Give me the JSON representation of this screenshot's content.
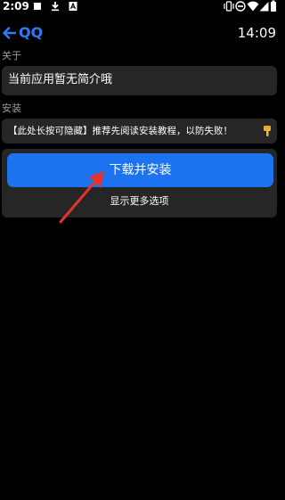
{
  "status_bar": {
    "time": "2:09",
    "notification_icons": [
      "square-notification-icon",
      "download-icon",
      "app-notification-icon"
    ],
    "system_icons": [
      "vibrate-icon",
      "do-not-disturb-icon",
      "wifi-icon",
      "signal-icon",
      "battery-icon"
    ]
  },
  "app_bar": {
    "title": "QQ",
    "clock": "14:09",
    "accent_color": "#2d7cf6"
  },
  "about": {
    "label": "关于",
    "text": "当前应用暂无简介哦"
  },
  "install": {
    "label": "安装",
    "notice": "【此处长按可隐藏】推荐先阅读安装教程，以防失败！",
    "notice_icon": "pointing-down-hand-icon",
    "download_button": "下载并安装",
    "more_options": "显示更多选项",
    "button_color": "#1d72ef"
  },
  "annotation": {
    "icon": "red-arrow-icon",
    "color": "#e8332a"
  }
}
